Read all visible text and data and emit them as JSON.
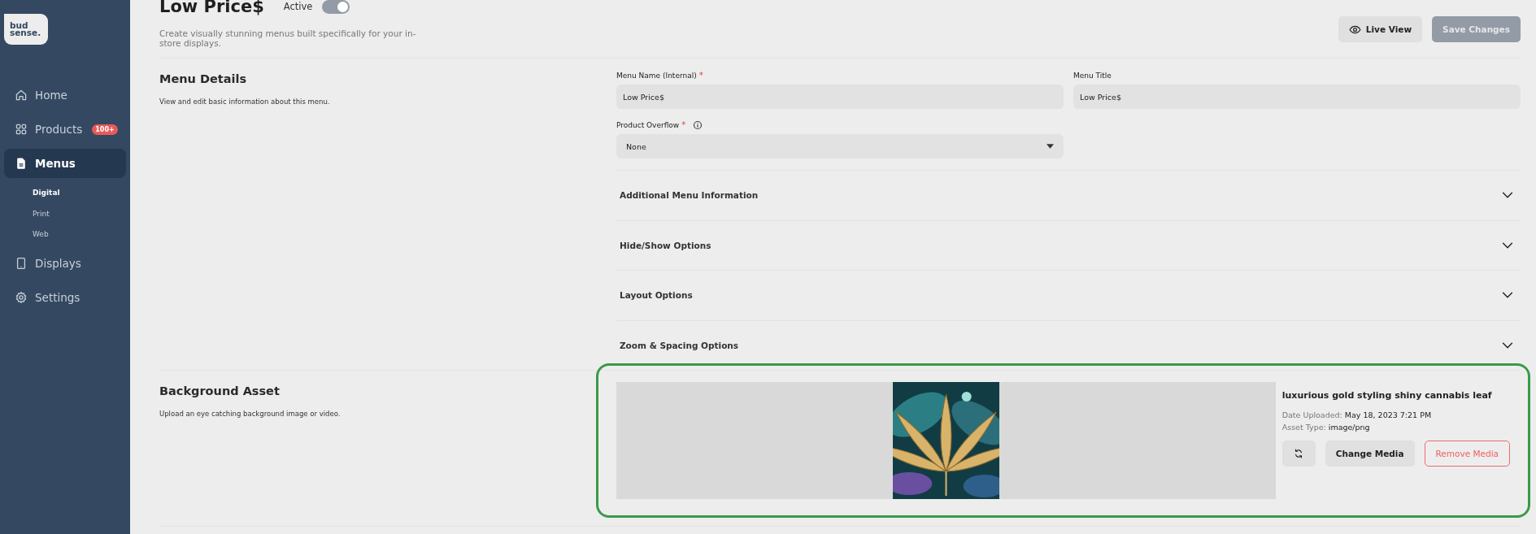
{
  "logo": {
    "lines": [
      "bud",
      "sense."
    ]
  },
  "sidebar": {
    "items": [
      {
        "label": "Home",
        "selected": false
      },
      {
        "label": "Products",
        "selected": false,
        "badge": "100+"
      },
      {
        "label": "Menus",
        "selected": true,
        "children": [
          {
            "label": "Digital",
            "selected": true
          },
          {
            "label": "Print",
            "selected": false
          },
          {
            "label": "Web",
            "selected": false
          }
        ]
      },
      {
        "label": "Displays",
        "selected": false
      },
      {
        "label": "Settings",
        "selected": false
      }
    ]
  },
  "header": {
    "title": "Low Price$",
    "status_label": "Active",
    "toggle": {
      "on": true
    },
    "description": "Create visually stunning menus built specifically for your in-store displays.",
    "buttons": [
      {
        "kind": "secondary",
        "label": "Live View",
        "disabled": false
      },
      {
        "kind": "primary",
        "label": "Save Changes",
        "disabled": true
      }
    ]
  },
  "menu_details": {
    "title": "Menu Details",
    "description": "View and edit basic information about this menu.",
    "fields": [
      {
        "kind": "input",
        "label": "Menu Name (Internal)",
        "required_mark": "*",
        "value": "Low Price$"
      },
      {
        "kind": "input",
        "label": "Menu Title",
        "value": "Low Price$"
      },
      {
        "kind": "select",
        "label": "Product Overflow",
        "required_mark": "*",
        "info": true,
        "value": "None"
      }
    ],
    "accordions": [
      {
        "label": "Additional Menu Information",
        "expanded": false
      },
      {
        "label": "Hide/Show Options",
        "expanded": false
      },
      {
        "label": "Layout Options",
        "expanded": false
      },
      {
        "label": "Zoom & Spacing Options",
        "expanded": false
      }
    ]
  },
  "background_asset": {
    "title": "Background Asset",
    "description": "Upload an eye catching background image or video.",
    "highlighted": true,
    "asset": {
      "kind": "picture",
      "name": "luxurious gold styling shiny cannabis leaf",
      "date_label": "Date Uploaded:",
      "date_value": "May 18, 2023 7:21 PM",
      "type_label": "Asset Type:",
      "type_value": "image/png"
    },
    "buttons": [
      {
        "kind": "icon"
      },
      {
        "kind": "secondary",
        "label": "Change Media"
      },
      {
        "kind": "danger",
        "label": "Remove Media"
      }
    ]
  }
}
